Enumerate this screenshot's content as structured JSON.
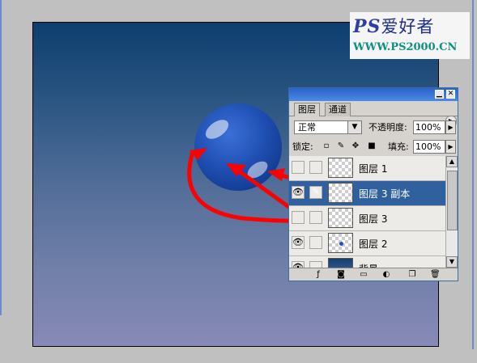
{
  "logo": {
    "brand_ps": "PS",
    "brand_cn": "爱好者",
    "url": "WWW.PS2000.CN"
  },
  "panel": {
    "tabs": [
      {
        "label": "图层",
        "active": true
      },
      {
        "label": "通道",
        "active": false
      }
    ],
    "blend_mode": "正常",
    "opacity_label": "不透明度:",
    "opacity_value": "100%",
    "lock_label": "锁定:",
    "fill_label": "填充:",
    "fill_value": "100%",
    "layers": [
      {
        "name": "图层 1",
        "visible": false,
        "selected": false
      },
      {
        "name": "图层 3 副本",
        "visible": true,
        "selected": true
      },
      {
        "name": "图层 3",
        "visible": false,
        "selected": false
      },
      {
        "name": "图层 2",
        "visible": true,
        "selected": false
      },
      {
        "name": "背景",
        "visible": true,
        "selected": false
      }
    ]
  },
  "icons": [
    "minimize-icon",
    "close-icon",
    "panel-menu-icon",
    "dropdown-arrow-icon",
    "lock-transparency-icon",
    "lock-paint-icon",
    "lock-move-icon",
    "lock-all-icon",
    "eye-icon",
    "brush-icon",
    "fx-icon",
    "mask-icon",
    "folder-icon",
    "adjustment-icon",
    "new-layer-icon",
    "trash-icon"
  ],
  "colors": {
    "selected_layer": "#31609e",
    "arrows": "#ff0000",
    "ball": "#1f4fb0"
  }
}
